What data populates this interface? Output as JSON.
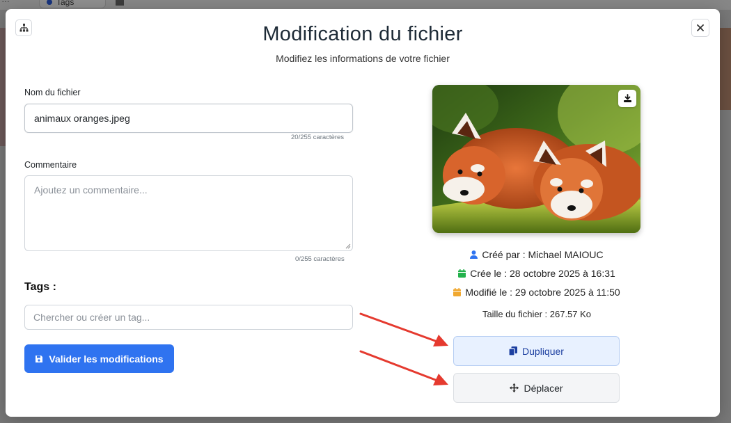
{
  "background": {
    "tab_label": "Tags"
  },
  "modal": {
    "title": "Modification du fichier",
    "subtitle": "Modifiez les informations de votre fichier"
  },
  "form": {
    "name_label": "Nom du fichier",
    "name_value": "animaux oranges.jpeg",
    "name_counter": "20/255 caractères",
    "comment_label": "Commentaire",
    "comment_placeholder": "Ajoutez un commentaire...",
    "comment_counter": "0/255 caractères",
    "tags_label": "Tags :",
    "tags_placeholder": "Chercher ou créer un tag...",
    "submit_label": "Valider les modifications"
  },
  "file_info": {
    "created_by": "Créé par : Michael MAIOUC",
    "created_on": "Crée le : 28 octobre 2025 à 16:31",
    "modified_on": "Modifié le : 29 octobre 2025 à 11:50",
    "file_size": "Taille du fichier : 267.57 Ko"
  },
  "actions": {
    "duplicate_label": "Dupliquer",
    "move_label": "Déplacer"
  },
  "colors": {
    "primary": "#2f73f0",
    "user_icon": "#2f73f0",
    "created_icon": "#23b24c",
    "modified_icon": "#f0a830",
    "arrow": "#e53a2f"
  },
  "icons": [
    "sitemap-icon",
    "close-icon",
    "save-icon",
    "download-icon",
    "user-icon",
    "calendar-icon",
    "copy-icon",
    "move-icon"
  ]
}
